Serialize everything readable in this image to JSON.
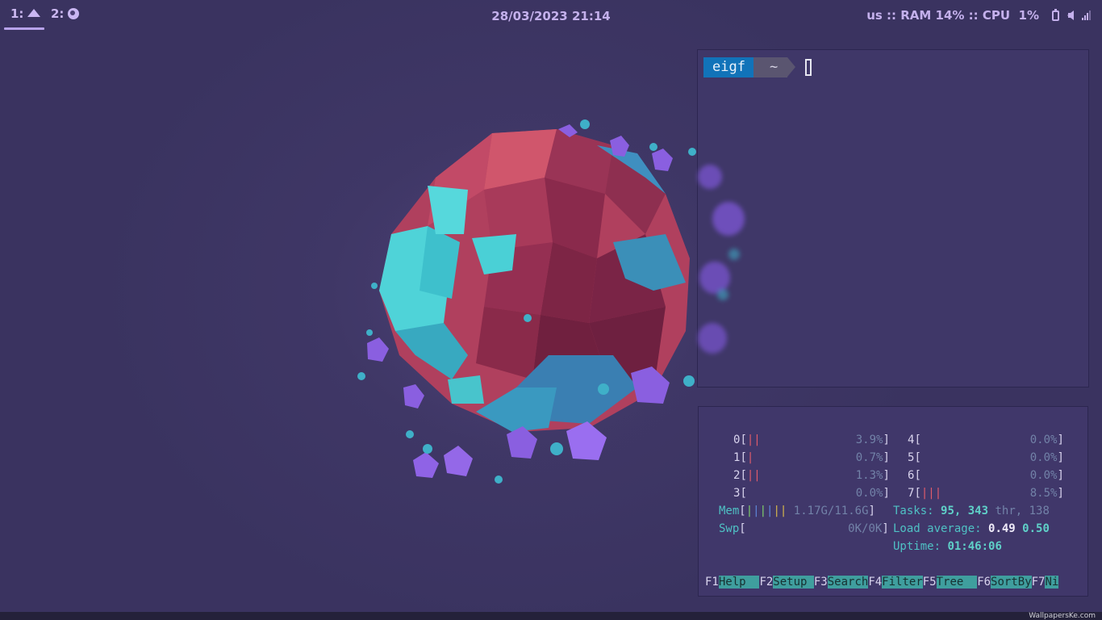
{
  "topbar": {
    "workspaces": [
      {
        "label": "1:",
        "icon": "rock-icon",
        "active": true
      },
      {
        "label": "2:",
        "icon": "firefox-icon",
        "active": false
      }
    ],
    "datetime": "28/03/2023 21:14",
    "status_text": "us :: RAM 14% :: CPU  1%",
    "tray_icons": [
      "battery-icon",
      "volume-icon",
      "signal-icon"
    ]
  },
  "terminal": {
    "user": "eigf",
    "dir": "~"
  },
  "htop": {
    "cpus": [
      {
        "id": "0",
        "usage": "3.9%",
        "bars": "||"
      },
      {
        "id": "1",
        "usage": "0.7%",
        "bars": "|"
      },
      {
        "id": "2",
        "usage": "1.3%",
        "bars": "||"
      },
      {
        "id": "3",
        "usage": "0.0%",
        "bars": ""
      },
      {
        "id": "4",
        "usage": "0.0%",
        "bars": ""
      },
      {
        "id": "5",
        "usage": "0.0%",
        "bars": ""
      },
      {
        "id": "6",
        "usage": "0.0%",
        "bars": ""
      },
      {
        "id": "7",
        "usage": "8.5%",
        "bars": "|||"
      }
    ],
    "mem_label": "Mem",
    "mem_value": "1.17G/11.6G",
    "swp_label": "Swp",
    "swp_value": "0K/0K",
    "tasks_label": "Tasks:",
    "tasks_count": "95",
    "threads_count": "343",
    "thr_label": "thr,",
    "running": "138",
    "load_label": "Load average:",
    "load1": "0.49",
    "load5": "0.50",
    "uptime_label": "Uptime:",
    "uptime": "01:46:06",
    "fkeys": [
      {
        "key": "F1",
        "label": "Help  "
      },
      {
        "key": "F2",
        "label": "Setup "
      },
      {
        "key": "F3",
        "label": "Search"
      },
      {
        "key": "F4",
        "label": "Filter"
      },
      {
        "key": "F5",
        "label": "Tree  "
      },
      {
        "key": "F6",
        "label": "SortBy"
      },
      {
        "key": "F7",
        "label": "Ni"
      }
    ]
  },
  "watermark": "WallpapersKe.com",
  "colors": {
    "background": "#3f3766",
    "accent": "#b7a2ea",
    "prompt_user_bg": "#1173b9",
    "fkey_bg": "#3f9e9e"
  }
}
